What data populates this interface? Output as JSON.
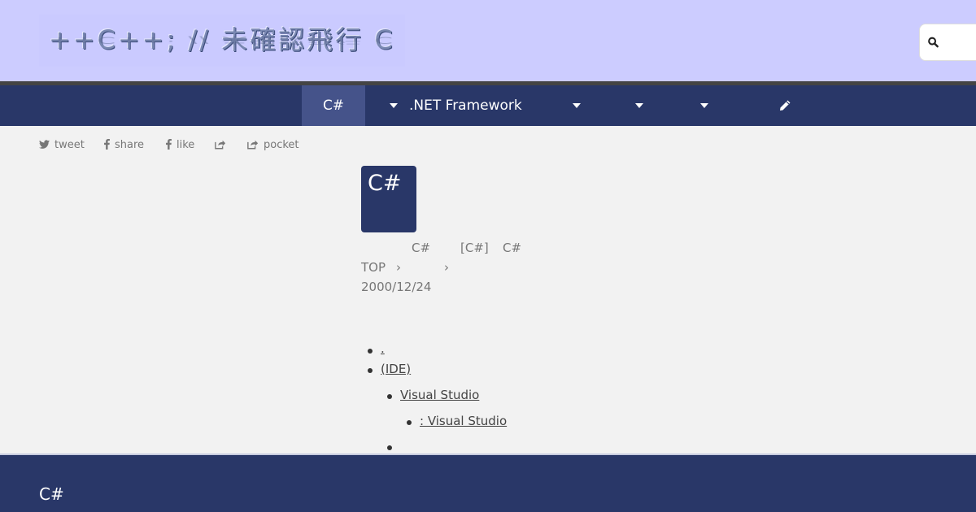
{
  "header": {
    "logo_text": "++C++; // 未確認飛行 C",
    "colors": {
      "header_bg": "#ccccff",
      "nav_bg": "#293768",
      "nav_active": "#45538a"
    }
  },
  "search": {
    "icon": "search-icon",
    "placeholder": ""
  },
  "nav": {
    "items": [
      {
        "label": "C#",
        "active": true
      },
      {
        "label": ".NET Framework",
        "dropdown": true
      },
      {
        "label": "",
        "dropdown": true
      },
      {
        "label": "",
        "dropdown": true
      },
      {
        "label": "",
        "dropdown": true
      }
    ],
    "edit_icon": "pencil-icon"
  },
  "share": {
    "items": [
      {
        "label": "tweet",
        "icon": "twitter-icon"
      },
      {
        "label": "share",
        "icon": "facebook-icon"
      },
      {
        "label": "like",
        "icon": "facebook-icon"
      },
      {
        "label": "",
        "icon": "share-icon"
      },
      {
        "label": "pocket",
        "icon": "share-icon"
      }
    ]
  },
  "article": {
    "category_icon_text": "C#",
    "tags_line": {
      "a": "C#",
      "b": "[C#]",
      "c": "C#"
    },
    "breadcrumb": {
      "top": "TOP",
      "sep": "›"
    },
    "date": "2000/12/24"
  },
  "toc": {
    "items": [
      {
        "label": "."
      },
      {
        "label": "(IDE)"
      },
      {
        "label": "Visual Studio"
      },
      {
        "label": ": Visual Studio "
      },
      {
        "label": ""
      }
    ]
  },
  "footer": {
    "title": "C#"
  }
}
